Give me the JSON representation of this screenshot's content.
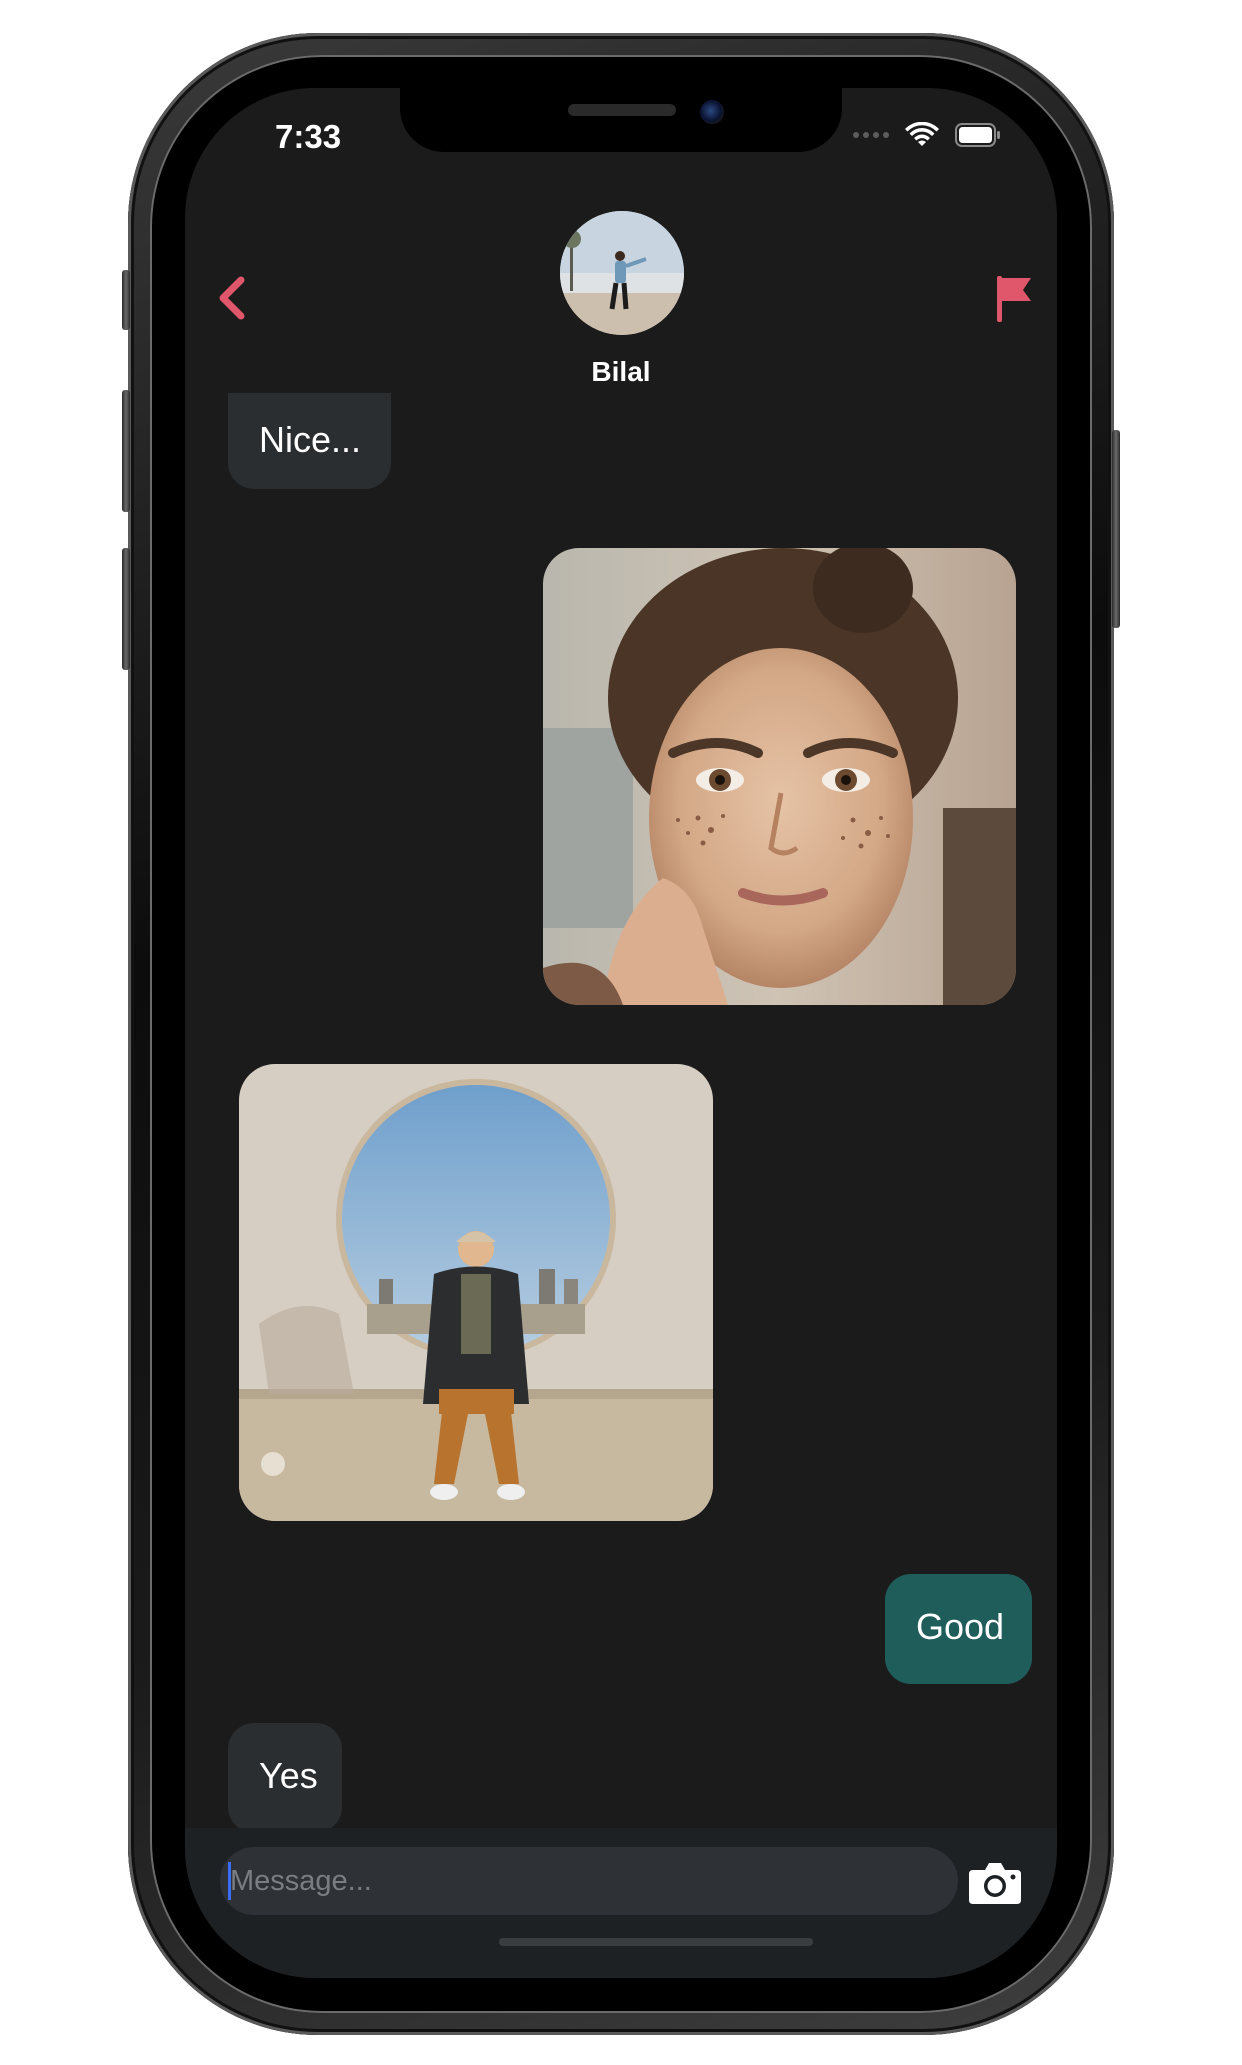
{
  "status_bar": {
    "time": "7:33"
  },
  "header": {
    "contact_name": "Bilal",
    "back_icon": "chevron-left-icon",
    "report_icon": "flag-icon",
    "accent_color": "#e0566a"
  },
  "messages": [
    {
      "direction": "incoming",
      "type": "text",
      "text": "Nice..."
    },
    {
      "direction": "outgoing",
      "type": "image",
      "subject": "woman-portrait"
    },
    {
      "direction": "incoming",
      "type": "image",
      "subject": "man-sitting-wall"
    },
    {
      "direction": "outgoing",
      "type": "text",
      "text": "Good"
    },
    {
      "direction": "incoming",
      "type": "text",
      "text": "Yes"
    }
  ],
  "composer": {
    "placeholder": "Message...",
    "value": "",
    "camera_icon": "camera-icon"
  },
  "colors": {
    "background": "#1b1b1b",
    "incoming_bubble": "#2a2e31",
    "outgoing_bubble": "#1f5d5a",
    "input_background": "#2e3236"
  }
}
